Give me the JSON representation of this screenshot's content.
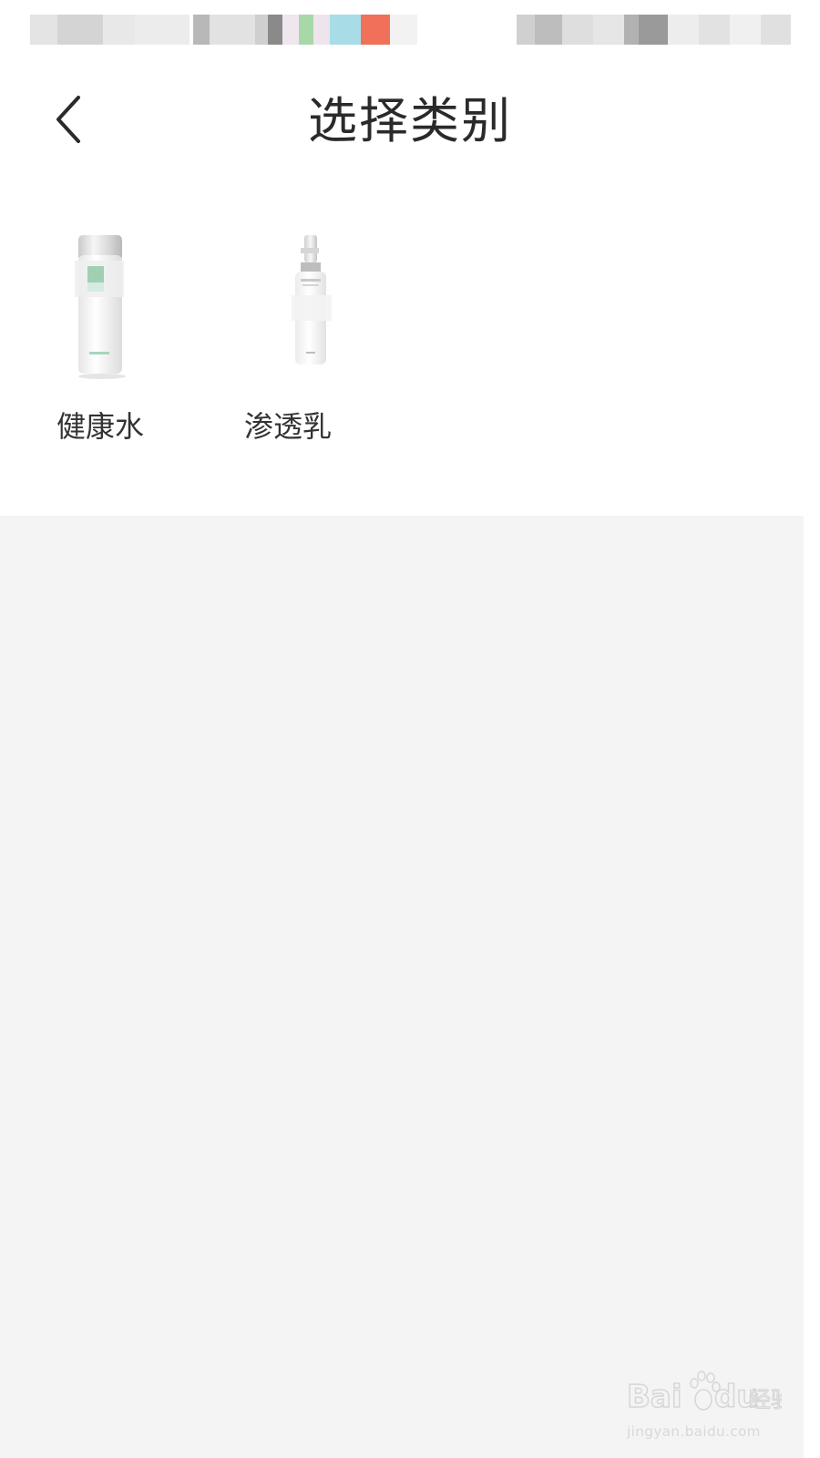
{
  "header": {
    "title": "选择类别",
    "back_icon": "chevron-left-icon"
  },
  "categories": [
    {
      "label": "健康水",
      "image": "toner-bottle-image"
    },
    {
      "label": "渗透乳",
      "image": "lotion-pump-bottle-image"
    }
  ],
  "watermark": {
    "logo": "Baidu经验",
    "url": "jingyan.baidu.com"
  },
  "colors": {
    "background": "#f4f4f4",
    "panel": "#ffffff",
    "title": "#2a2a2a",
    "label": "#333333",
    "status_accent_red": "#f0705a",
    "status_accent_blue": "#a8dde8",
    "status_accent_green": "#a8d8a8"
  }
}
